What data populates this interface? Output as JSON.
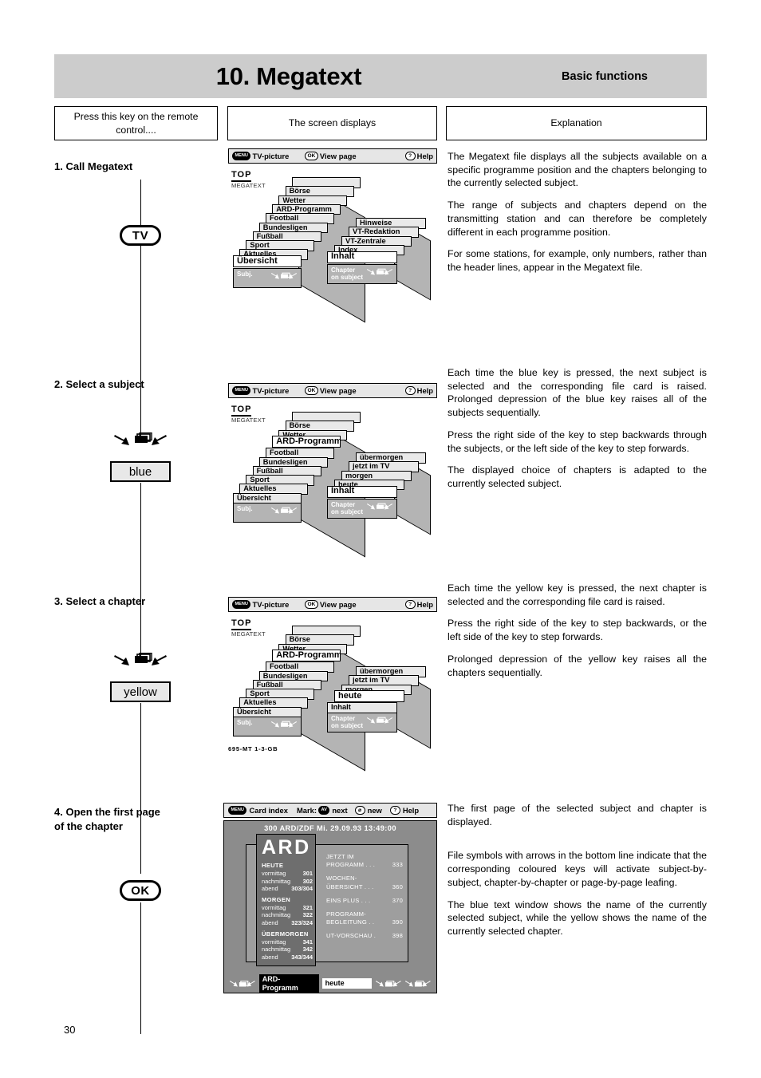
{
  "header": {
    "title": "10. Megatext",
    "subtitle": "Basic functions"
  },
  "columns": [
    {
      "label": "Press this key on the remote control...."
    },
    {
      "label": "The screen displays"
    },
    {
      "label": "Explanation"
    }
  ],
  "page_number": "30",
  "footer_code": "695-MT 1-3-GB",
  "steps": [
    {
      "title": "1. Call Megatext",
      "key_type": "tv",
      "key_label": "TV",
      "icon": "none",
      "explanation": [
        "The Megatext file displays all the subjects available on a specific programme position and the chapters belonging to the currently selected subject.",
        "The range of subjects and chapters depend on the transmitting station and can therefore be completely different in each programme position.",
        "For some stations, for example, only numbers, rather than the header lines, appear in the Megatext file."
      ]
    },
    {
      "title": "2. Select a subject",
      "key_type": "colour",
      "key_label": "blue",
      "icon": "card-index-arrows-icon",
      "explanation": [
        "Each time the blue key is pressed, the next subject is selected and the corresponding file card is raised. Prolonged depression of the blue key raises all of the subjects sequentially.",
        "Press the right side of the key to step backwards through the subjects, or the left side of the key to step forwards.",
        "The displayed choice of chapters is adapted to the currently selected subject."
      ]
    },
    {
      "title": "3. Select a chapter",
      "key_type": "colour",
      "key_label": "yellow",
      "icon": "card-index-arrows-icon",
      "explanation": [
        "Each time the yellow key is pressed, the next chapter is selected and the corresponding file card is raised.",
        "Press the right side of the key to step backwards, or the left side of the key to step forwards.",
        "Prolonged depression of the yellow key raises all the chapters sequentially."
      ]
    },
    {
      "title": "4. Open the first page\n    of the chapter",
      "key_type": "ok",
      "key_label": "OK",
      "icon": "none",
      "explanation": [
        "The first page of the selected subject and chapter is displayed.",
        "File symbols with arrows in the bottom line indicate that the corresponding coloured keys will activate subject-by-subject, chapter-by-chapter or page-by-page leafing.",
        "The blue text window shows the name of the currently selected subject, while the yellow shows the name of the currently selected chapter."
      ]
    }
  ],
  "tv_bar": {
    "menu_badge": "MENU",
    "menu_label": "TV-picture",
    "ok_badge": "OK",
    "ok_label": "View page",
    "help_badge": "?",
    "help_label": "Help"
  },
  "card_bar": {
    "menu_badge": "MENU",
    "menu_label": "Card index",
    "mark_label": "Mark:",
    "av_badge": "AV",
    "av_label": "next",
    "new_badge": "⌀",
    "new_label": "new",
    "help_badge": "?",
    "help_label": "Help"
  },
  "logo": {
    "line1": "TOP",
    "line2": "MEGATEXT"
  },
  "screens": [
    {
      "id": "screen-1-call-megatext",
      "subject_stack": {
        "base_label": "Subj.",
        "cards": [
          "",
          "Börse",
          "Wetter",
          "ARD-Programm",
          "Football",
          "Bundesligen",
          "Fußball",
          "Sport",
          "Aktuelles",
          "Übersicht"
        ],
        "raised": "Übersicht"
      },
      "chapter_stack": {
        "base_label": "Chapter\non subject",
        "cards": [
          "Hinweise",
          "VT-Redaktion",
          "VT-Zentrale",
          "Index",
          "Inhalt"
        ],
        "raised": "Inhalt"
      }
    },
    {
      "id": "screen-2-select-subject",
      "subject_stack": {
        "base_label": "Subj.",
        "cards": [
          "",
          "Börse",
          "Wetter",
          "ARD-Programm",
          "Football",
          "Bundesligen",
          "Fußball",
          "Sport",
          "Aktuelles",
          "Übersicht"
        ],
        "raised": "ARD-Programm"
      },
      "chapter_stack": {
        "base_label": "Chapter\non subject",
        "cards": [
          "übermorgen",
          "jetzt im TV",
          "morgen",
          "heute",
          "Inhalt"
        ],
        "raised": "Inhalt"
      }
    },
    {
      "id": "screen-3-select-chapter",
      "subject_stack": {
        "base_label": "Subj.",
        "cards": [
          "",
          "Börse",
          "Wetter",
          "ARD-Programm",
          "Football",
          "Bundesligen",
          "Fußball",
          "Sport",
          "Aktuelles",
          "Übersicht"
        ],
        "raised": "ARD-Programm"
      },
      "chapter_stack": {
        "base_label": "Chapter\non subject",
        "cards": [
          "übermorgen",
          "jetzt im TV",
          "morgen",
          "heute",
          "Inhalt"
        ],
        "raised": "heute"
      }
    }
  ],
  "teletext": {
    "header": "300  ARD/ZDF  Mi. 29.09.93  13:49:00",
    "logo": "ARD",
    "groups": [
      {
        "title": "HEUTE",
        "rows": [
          {
            "label": "vormittag",
            "page": "301"
          },
          {
            "label": "nachmittag",
            "page": "302"
          },
          {
            "label": "abend",
            "page": "303/304"
          }
        ]
      },
      {
        "title": "MORGEN",
        "rows": [
          {
            "label": "vormittag",
            "page": "321"
          },
          {
            "label": "nachmittag",
            "page": "322"
          },
          {
            "label": "abend",
            "page": "323/324"
          }
        ]
      },
      {
        "title": "ÜBERMORGEN",
        "rows": [
          {
            "label": "vormittag",
            "page": "341"
          },
          {
            "label": "nachmittag",
            "page": "342"
          },
          {
            "label": "abend",
            "page": "343/344"
          }
        ]
      }
    ],
    "right_items": [
      {
        "line1": "JETZT IM",
        "line2": "PROGRAMM . . .",
        "page": "333"
      },
      {
        "line1": "WOCHEN-",
        "line2": "ÜBERSICHT . . .",
        "page": "360"
      },
      {
        "line1": "",
        "line2": "EINS PLUS . . .",
        "page": "370"
      },
      {
        "line1": "PROGRAMM-",
        "line2": "BEGLEITUNG . .",
        "page": "390"
      },
      {
        "line1": "",
        "line2": "UT-VORSCHAU .",
        "page": "398"
      }
    ],
    "footer": {
      "subject_tag": "ARD-Programm",
      "chapter_tag": "heute"
    }
  }
}
